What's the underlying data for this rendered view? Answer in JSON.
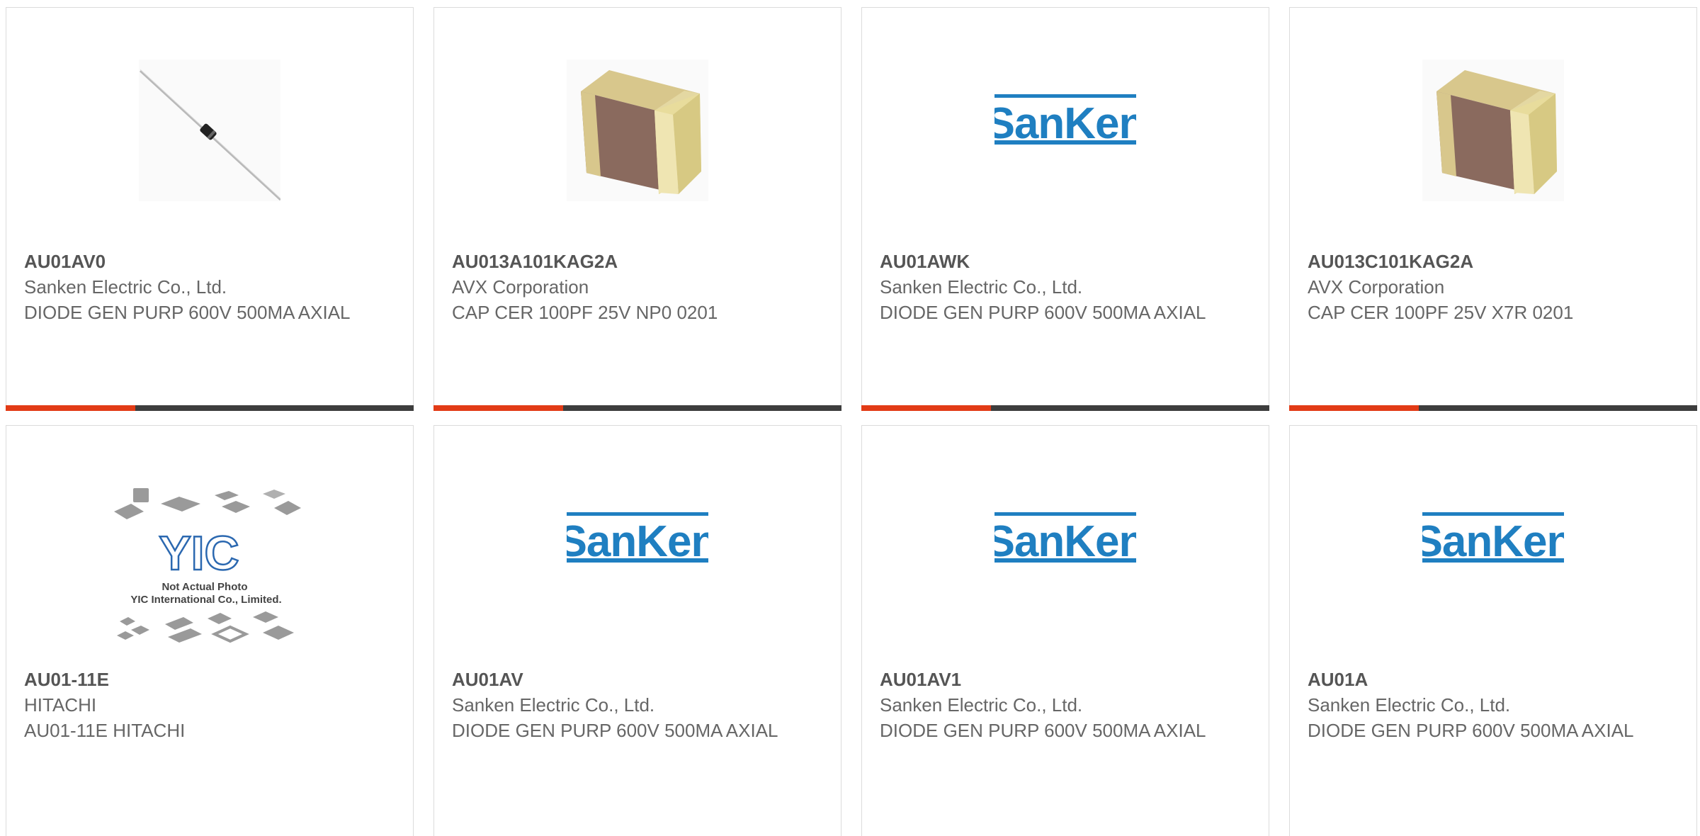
{
  "products": [
    {
      "part": "AU01AV0",
      "manufacturer": "Sanken Electric Co., Ltd.",
      "description": "DIODE GEN PURP 600V 500MA AXIAL",
      "image": "diode-axial-icon"
    },
    {
      "part": "AU013A101KAG2A",
      "manufacturer": "AVX Corporation",
      "description": "CAP CER 100PF 25V NP0 0201",
      "image": "ceramic-capacitor-icon"
    },
    {
      "part": "AU01AWK",
      "manufacturer": "Sanken Electric Co., Ltd.",
      "description": "DIODE GEN PURP 600V 500MA AXIAL",
      "image": "sanken-logo"
    },
    {
      "part": "AU013C101KAG2A",
      "manufacturer": "AVX Corporation",
      "description": "CAP CER 100PF 25V X7R 0201",
      "image": "ceramic-capacitor-icon"
    },
    {
      "part": "AU01-11E",
      "manufacturer": "HITACHI",
      "description": "AU01-11E HITACHI",
      "image": "yic-placeholder-image"
    },
    {
      "part": "AU01AV",
      "manufacturer": "Sanken Electric Co., Ltd.",
      "description": "DIODE GEN PURP 600V 500MA AXIAL",
      "image": "sanken-logo"
    },
    {
      "part": "AU01AV1",
      "manufacturer": "Sanken Electric Co., Ltd.",
      "description": "DIODE GEN PURP 600V 500MA AXIAL",
      "image": "sanken-logo"
    },
    {
      "part": "AU01A",
      "manufacturer": "Sanken Electric Co., Ltd.",
      "description": "DIODE GEN PURP 600V 500MA AXIAL",
      "image": "sanken-logo"
    }
  ],
  "placeholder": {
    "line1": "Not Actual Photo",
    "line2": "YIC International Co., Limited.",
    "logo": "YIC"
  },
  "logo_text": "SanKen",
  "colors": {
    "accent": "#e23b16",
    "bar": "#3d3d3d",
    "sanken_blue": "#1f7fc1",
    "text": "#666666"
  }
}
